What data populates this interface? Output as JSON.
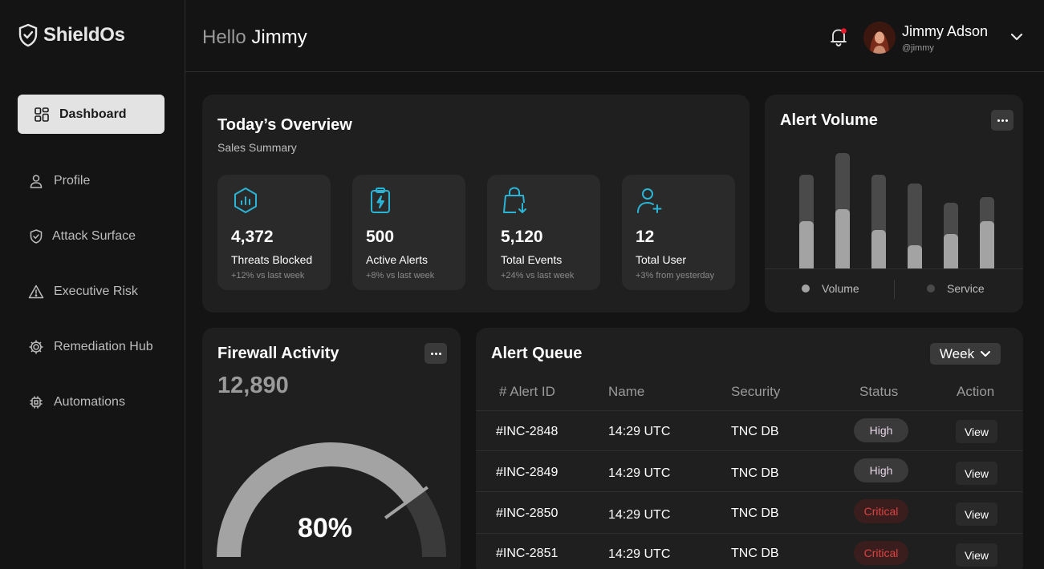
{
  "app": {
    "name": "ShieldOs"
  },
  "sidebar": {
    "items": [
      {
        "label": "Dashboard",
        "icon": "grid-icon",
        "active": true
      },
      {
        "label": "Profile",
        "icon": "user-icon"
      },
      {
        "label": "Attack Surface",
        "icon": "shield-check-icon"
      },
      {
        "label": "Executive Risk",
        "icon": "warning-icon"
      },
      {
        "label": "Remediation Hub",
        "icon": "gear-icon"
      },
      {
        "label": "Automations",
        "icon": "chip-icon"
      }
    ]
  },
  "header": {
    "hello": "Hello",
    "name": "Jimmy",
    "user_name": "Jimmy Adson",
    "user_handle": "@jimmy"
  },
  "overview": {
    "title": "Today’s Overview",
    "subtitle": "Sales Summary",
    "stats": [
      {
        "value": "4,372",
        "label": "Threats Blocked",
        "change": "+12% vs last week",
        "icon": "shield-chart-icon"
      },
      {
        "value": "500",
        "label": "Active Alerts",
        "change": "+8% vs last week",
        "icon": "clipboard-bolt-icon"
      },
      {
        "value": "5,120",
        "label": "Total Events",
        "change": "+24% vs last week",
        "icon": "bag-download-icon"
      },
      {
        "value": "12",
        "label": "Total User",
        "change": "+3% from yesterday",
        "icon": "user-add-icon"
      }
    ]
  },
  "alert_volume": {
    "title": "Alert Volume",
    "legend": [
      "Volume",
      "Service"
    ]
  },
  "chart_data": {
    "type": "bar",
    "categories": [
      "",
      "",
      "",
      "",
      "",
      ""
    ],
    "series": [
      {
        "name": "Volume",
        "values": [
          59,
          74,
          48,
          29,
          43,
          59
        ]
      },
      {
        "name": "Service",
        "values": [
          117,
          144,
          117,
          106,
          82,
          89
        ]
      }
    ],
    "title": "Alert Volume",
    "ylim": [
      0,
      144
    ],
    "legend_position": "bottom"
  },
  "firewall": {
    "title": "Firewall Activity",
    "value": "12,890",
    "percent_label": "80%",
    "percent": 80
  },
  "alert_queue": {
    "title": "Alert Queue",
    "period": "Week",
    "columns": [
      "# Alert ID",
      "Name",
      "Security",
      "Status",
      "Action"
    ],
    "rows": [
      {
        "id": "#INC-2848",
        "name": "14:29 UTC",
        "security": "TNC DB",
        "status": "High",
        "action": "View"
      },
      {
        "id": "#INC-2849",
        "name": "14:29 UTC",
        "security": "TNC DB",
        "status": "High",
        "action": "View"
      },
      {
        "id": "#INC-2850",
        "name": "14:29 UTC",
        "security": "TNC DB",
        "status": "Critical",
        "action": "View"
      },
      {
        "id": "#INC-2851",
        "name": "14:29 UTC",
        "security": "TNC DB",
        "status": "Critical",
        "action": "View"
      }
    ]
  },
  "colors": {
    "accent": "#2ab5d6",
    "critical": "#e04040",
    "notification": "#e8192c"
  }
}
